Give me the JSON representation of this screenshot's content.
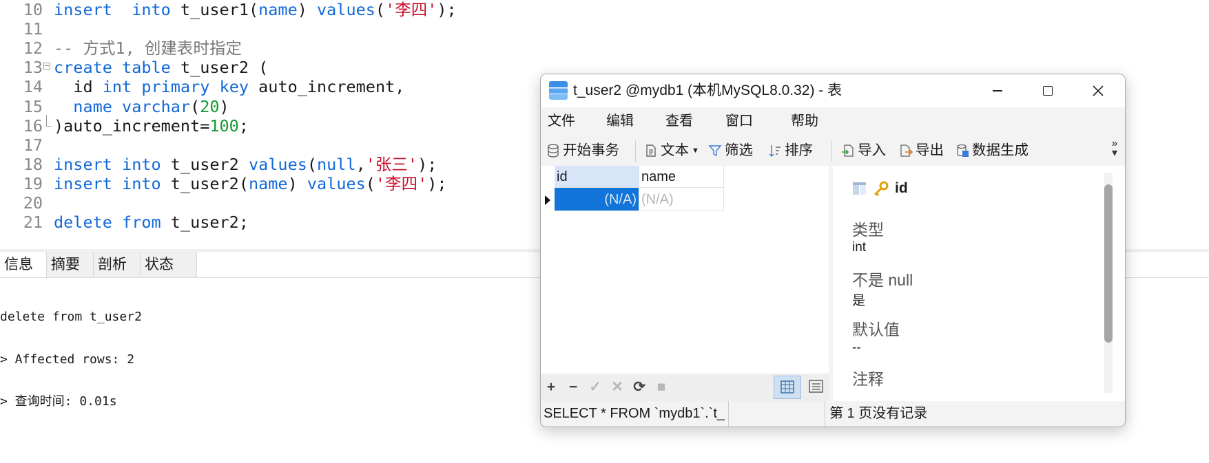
{
  "editor": {
    "lines": [
      {
        "num": "10",
        "tokens": [
          [
            "kw",
            "insert"
          ],
          [
            "",
            "  "
          ],
          [
            "kw",
            "into"
          ],
          [
            "",
            " t_user1("
          ],
          [
            "kw",
            "name"
          ],
          [
            "",
            ") "
          ],
          [
            "kw",
            "values"
          ],
          [
            "",
            "("
          ],
          [
            "str",
            "'李四'"
          ],
          [
            "",
            ");"
          ]
        ]
      },
      {
        "num": "11",
        "tokens": []
      },
      {
        "num": "12",
        "tokens": [
          [
            "cmt",
            "-- 方式1, 创建表时指定"
          ]
        ]
      },
      {
        "num": "13",
        "tokens": [
          [
            "kw",
            "create"
          ],
          [
            "",
            " "
          ],
          [
            "kw",
            "table"
          ],
          [
            "",
            " t_user2 ("
          ]
        ]
      },
      {
        "num": "14",
        "tokens": [
          [
            "",
            "  id "
          ],
          [
            "kw",
            "int"
          ],
          [
            "",
            " "
          ],
          [
            "kw",
            "primary"
          ],
          [
            "",
            " "
          ],
          [
            "kw",
            "key"
          ],
          [
            "",
            " auto_increment,"
          ]
        ]
      },
      {
        "num": "15",
        "tokens": [
          [
            "",
            "  "
          ],
          [
            "kw",
            "name"
          ],
          [
            "",
            " "
          ],
          [
            "kw",
            "varchar"
          ],
          [
            "",
            "("
          ],
          [
            "num",
            "20"
          ],
          [
            "",
            ")"
          ]
        ]
      },
      {
        "num": "16",
        "tokens": [
          [
            "",
            ")auto_increment="
          ],
          [
            "num",
            "100"
          ],
          [
            "",
            ";"
          ]
        ]
      },
      {
        "num": "17",
        "tokens": []
      },
      {
        "num": "18",
        "tokens": [
          [
            "kw",
            "insert"
          ],
          [
            "",
            " "
          ],
          [
            "kw",
            "into"
          ],
          [
            "",
            " t_user2 "
          ],
          [
            "kw",
            "values"
          ],
          [
            "",
            "("
          ],
          [
            "kw",
            "null"
          ],
          [
            "",
            ","
          ],
          [
            "str",
            "'张三'"
          ],
          [
            "",
            ");"
          ]
        ]
      },
      {
        "num": "19",
        "tokens": [
          [
            "kw",
            "insert"
          ],
          [
            "",
            " "
          ],
          [
            "kw",
            "into"
          ],
          [
            "",
            " t_user2("
          ],
          [
            "kw",
            "name"
          ],
          [
            "",
            ") "
          ],
          [
            "kw",
            "values"
          ],
          [
            "",
            "("
          ],
          [
            "str",
            "'李四'"
          ],
          [
            "",
            ");"
          ]
        ]
      },
      {
        "num": "20",
        "tokens": []
      },
      {
        "num": "21",
        "tokens": [
          [
            "kw",
            "delete"
          ],
          [
            "",
            " "
          ],
          [
            "kw",
            "from"
          ],
          [
            "",
            " t_user2;"
          ]
        ]
      }
    ]
  },
  "result_tabs": [
    "信息",
    "摘要",
    "剖析",
    "状态"
  ],
  "messages": [
    "delete from t_user2",
    "> Affected rows: 2",
    "> 查询时间: 0.01s"
  ],
  "window": {
    "title": "t_user2 @mydb1 (本机MySQL8.0.32) - 表",
    "menu": [
      "文件",
      "编辑",
      "查看",
      "窗口",
      "帮助"
    ],
    "toolbar": {
      "begin_tx": "开始事务",
      "text": "文本",
      "filter": "筛选",
      "sort": "排序",
      "import": "导入",
      "export": "导出",
      "datagen": "数据生成"
    },
    "grid": {
      "columns": [
        "id",
        "name"
      ],
      "rows": [
        [
          "(N/A)",
          "(N/A)"
        ]
      ]
    },
    "grid_buttons": [
      "+",
      "−",
      "✓",
      "✕",
      "⟳",
      "■"
    ],
    "panel": {
      "field": "id",
      "type_label": "类型",
      "type_value": "int",
      "notnull_label": "不是 null",
      "notnull_value": "是",
      "default_label": "默认值",
      "default_value": "--",
      "comment_label": "注释"
    },
    "status": {
      "sql": "SELECT * FROM `mydb1`.`t_",
      "records": "第 1 页没有记录"
    }
  }
}
